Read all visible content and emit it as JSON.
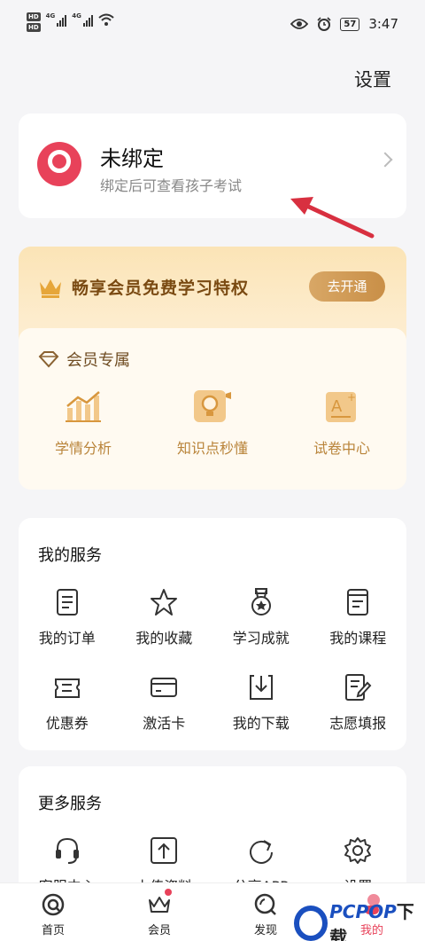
{
  "status_bar": {
    "hd_labels": [
      "HD",
      "HD"
    ],
    "network_labels": [
      "4G",
      "4G"
    ],
    "battery": "57",
    "time": "3:47"
  },
  "header": {
    "settings_label": "设置"
  },
  "bind_card": {
    "title": "未绑定",
    "subtitle": "绑定后可查看孩子考试"
  },
  "vip": {
    "promo_text": "畅享会员免费学习特权",
    "open_button": "去开通",
    "exclusive_title": "会员专属",
    "items": [
      {
        "label": "学情分析",
        "icon": "chart-icon"
      },
      {
        "label": "知识点秒懂",
        "icon": "lightbulb-icon"
      },
      {
        "label": "试卷中心",
        "icon": "exam-paper-icon"
      }
    ]
  },
  "my_services": {
    "title": "我的服务",
    "items": [
      {
        "label": "我的订单",
        "icon": "order-icon"
      },
      {
        "label": "我的收藏",
        "icon": "star-icon"
      },
      {
        "label": "学习成就",
        "icon": "medal-icon"
      },
      {
        "label": "我的课程",
        "icon": "course-book-icon"
      },
      {
        "label": "优惠券",
        "icon": "coupon-icon"
      },
      {
        "label": "激活卡",
        "icon": "card-icon"
      },
      {
        "label": "我的下载",
        "icon": "download-icon"
      },
      {
        "label": "志愿填报",
        "icon": "form-edit-icon"
      }
    ]
  },
  "more_services": {
    "title": "更多服务",
    "items": [
      {
        "label": "客服中心",
        "icon": "headset-icon"
      },
      {
        "label": "上传资料",
        "icon": "upload-icon"
      },
      {
        "label": "分享APP",
        "icon": "share-icon"
      },
      {
        "label": "设置",
        "icon": "gear-icon"
      }
    ]
  },
  "tab_bar": {
    "items": [
      {
        "label": "首页",
        "icon": "home-icon"
      },
      {
        "label": "会员",
        "icon": "crown-icon"
      },
      {
        "label": "发现",
        "icon": "discover-icon"
      },
      {
        "label": "我的",
        "icon": "profile-icon"
      }
    ],
    "active": "我的"
  },
  "watermark": {
    "text_a": "PCPOP",
    "text_b": "下载"
  },
  "colors": {
    "accent": "#e8425a",
    "gold": "#b9843a",
    "vip_bg": "#fbe4b6"
  }
}
